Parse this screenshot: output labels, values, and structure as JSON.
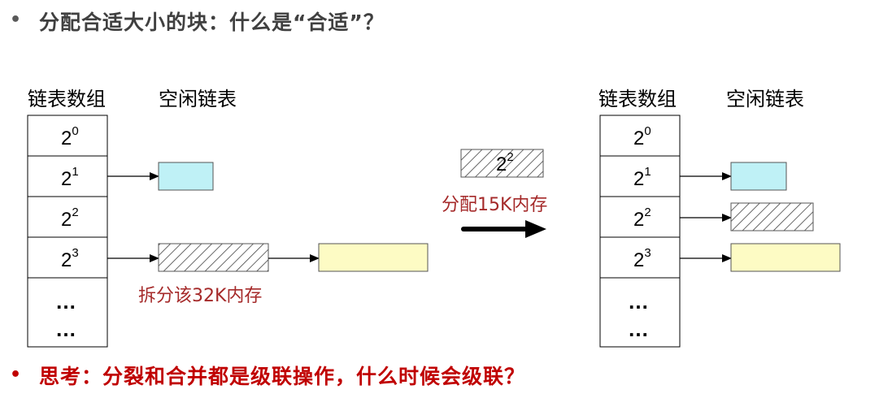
{
  "slide": {
    "title": "分配合适大小的块：什么是“合适”？",
    "question": "思考：分裂和合并都是级联操作，什么时候会级联？"
  },
  "left": {
    "array_header": "链表数组",
    "freelist_header": "空闲链表",
    "split_label": "拆分该32K内存"
  },
  "right": {
    "array_header": "链表数组",
    "freelist_header": "空闲链表"
  },
  "middle": {
    "allocated_base": "2",
    "allocated_exp": "2",
    "alloc_label": "分配15K内存"
  },
  "array_rows": [
    {
      "base": "2",
      "exp": "0"
    },
    {
      "base": "2",
      "exp": "1"
    },
    {
      "base": "2",
      "exp": "2"
    },
    {
      "base": "2",
      "exp": "3"
    }
  ],
  "ellipsis": "…",
  "colors": {
    "cyan_block": "#bff1f6",
    "yellow_block": "#fdfbc4",
    "hatch_block": "#555555",
    "title_text": "#404040",
    "question_text": "#c00000",
    "label_text": "#a52a2a"
  }
}
